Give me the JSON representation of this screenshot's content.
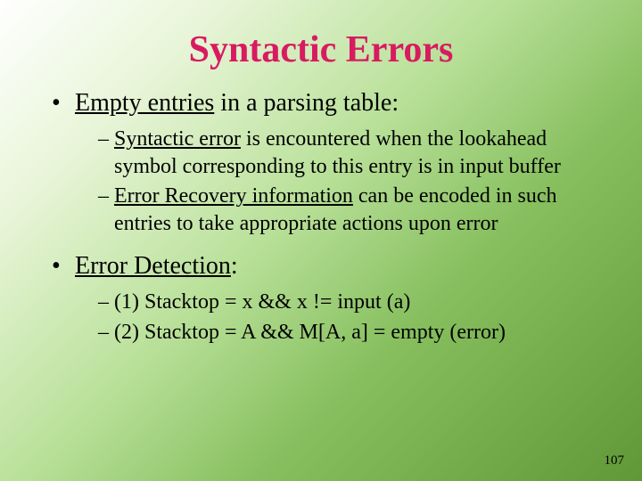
{
  "title": "Syntactic Errors",
  "bullets": [
    {
      "dot": "•",
      "lead": "Empty entries",
      "rest": " in a parsing table:",
      "subs": [
        {
          "dash": "–",
          "lead": "Syntactic error",
          "rest": " is encountered when the lookahead symbol corresponding to this entry is in input buffer"
        },
        {
          "dash": "–",
          "lead": "Error Recovery information",
          "rest": " can be encoded in such entries to take appropriate actions upon error"
        }
      ]
    },
    {
      "dot": "•",
      "lead": "Error Detection",
      "rest": ":",
      "subs": [
        {
          "dash": "–",
          "lead": "",
          "rest": "(1) Stacktop = x  && x != input (a)"
        },
        {
          "dash": "–",
          "lead": "",
          "rest": "(2) Stacktop = A && M[A, a] = empty (error)"
        }
      ]
    }
  ],
  "page_number": "107"
}
